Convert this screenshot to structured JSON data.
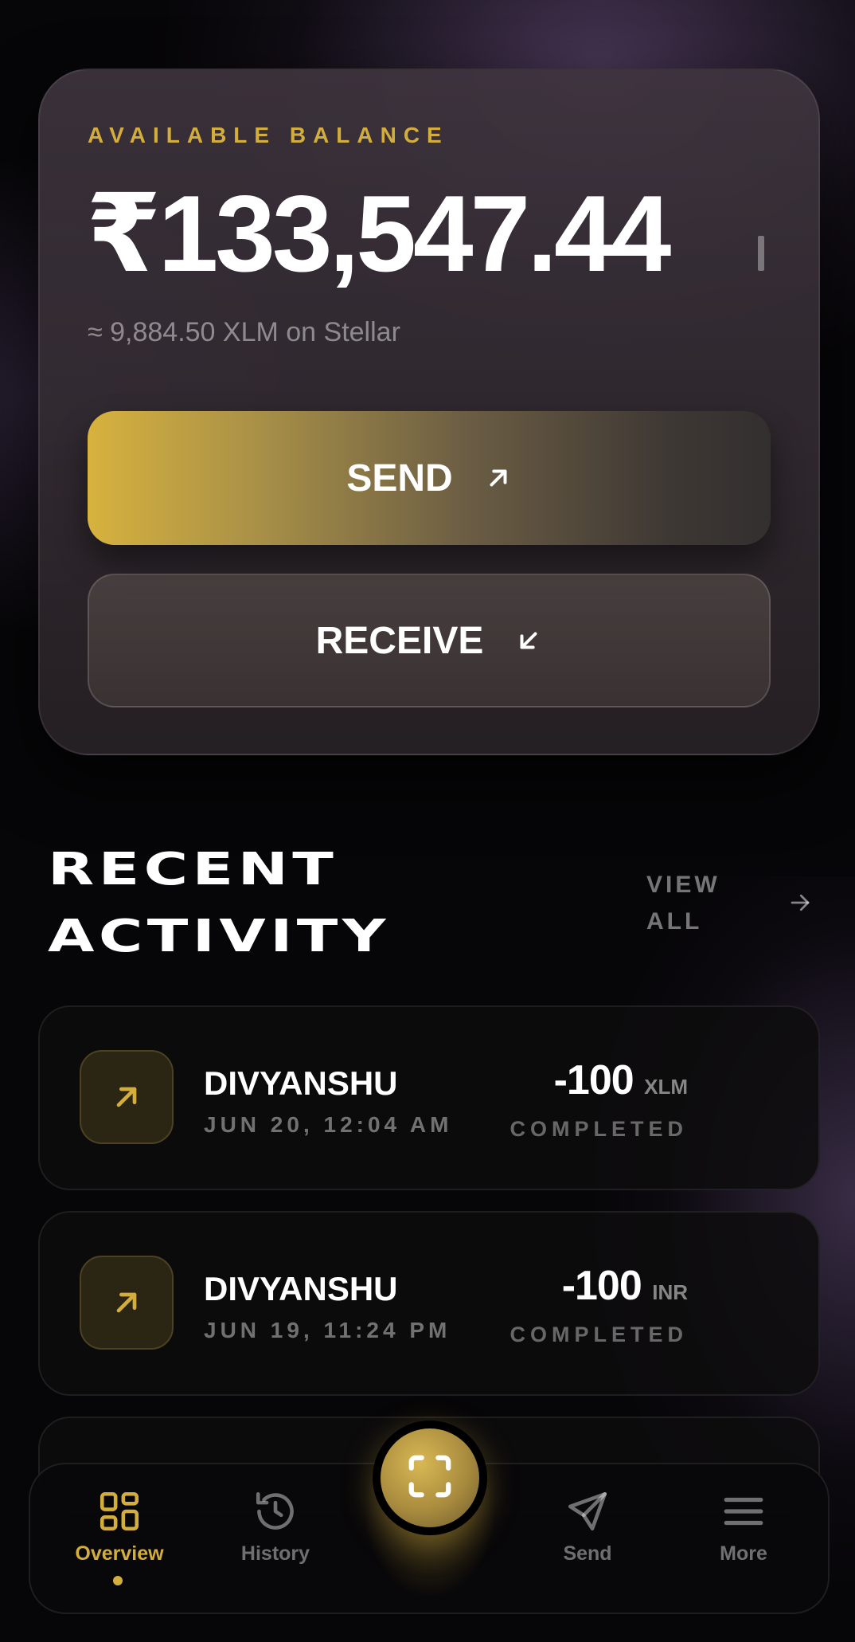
{
  "balance": {
    "label": "AVAILABLE BALANCE",
    "amount": "₹133,547.44",
    "sub": "≈ 9,884.50 XLM on Stellar"
  },
  "actions": {
    "send_label": "SEND",
    "receive_label": "RECEIVE"
  },
  "activity": {
    "title_line1": "RECENT",
    "title_line2": "ACTIVITY",
    "view_all_line1": "VIEW",
    "view_all_line2": "ALL",
    "transactions": [
      {
        "name": "DIVYANSHU",
        "date": "JUN 20, 12:04 AM",
        "amount": "-100",
        "unit": "XLM",
        "status": "COMPLETED"
      },
      {
        "name": "DIVYANSHU",
        "date": "JUN 19, 11:24 PM",
        "amount": "-100",
        "unit": "INR",
        "status": "COMPLETED"
      }
    ]
  },
  "nav": {
    "items": [
      {
        "label": "Overview",
        "icon": "grid-icon",
        "active": true
      },
      {
        "label": "History",
        "icon": "history-icon",
        "active": false
      },
      {
        "label": "Send",
        "icon": "paper-plane-icon",
        "active": false
      },
      {
        "label": "More",
        "icon": "menu-icon",
        "active": false
      }
    ],
    "center_icon": "scan-icon"
  },
  "colors": {
    "accent": "#d4ae3c",
    "background": "#060507",
    "card": "#2c2629"
  }
}
